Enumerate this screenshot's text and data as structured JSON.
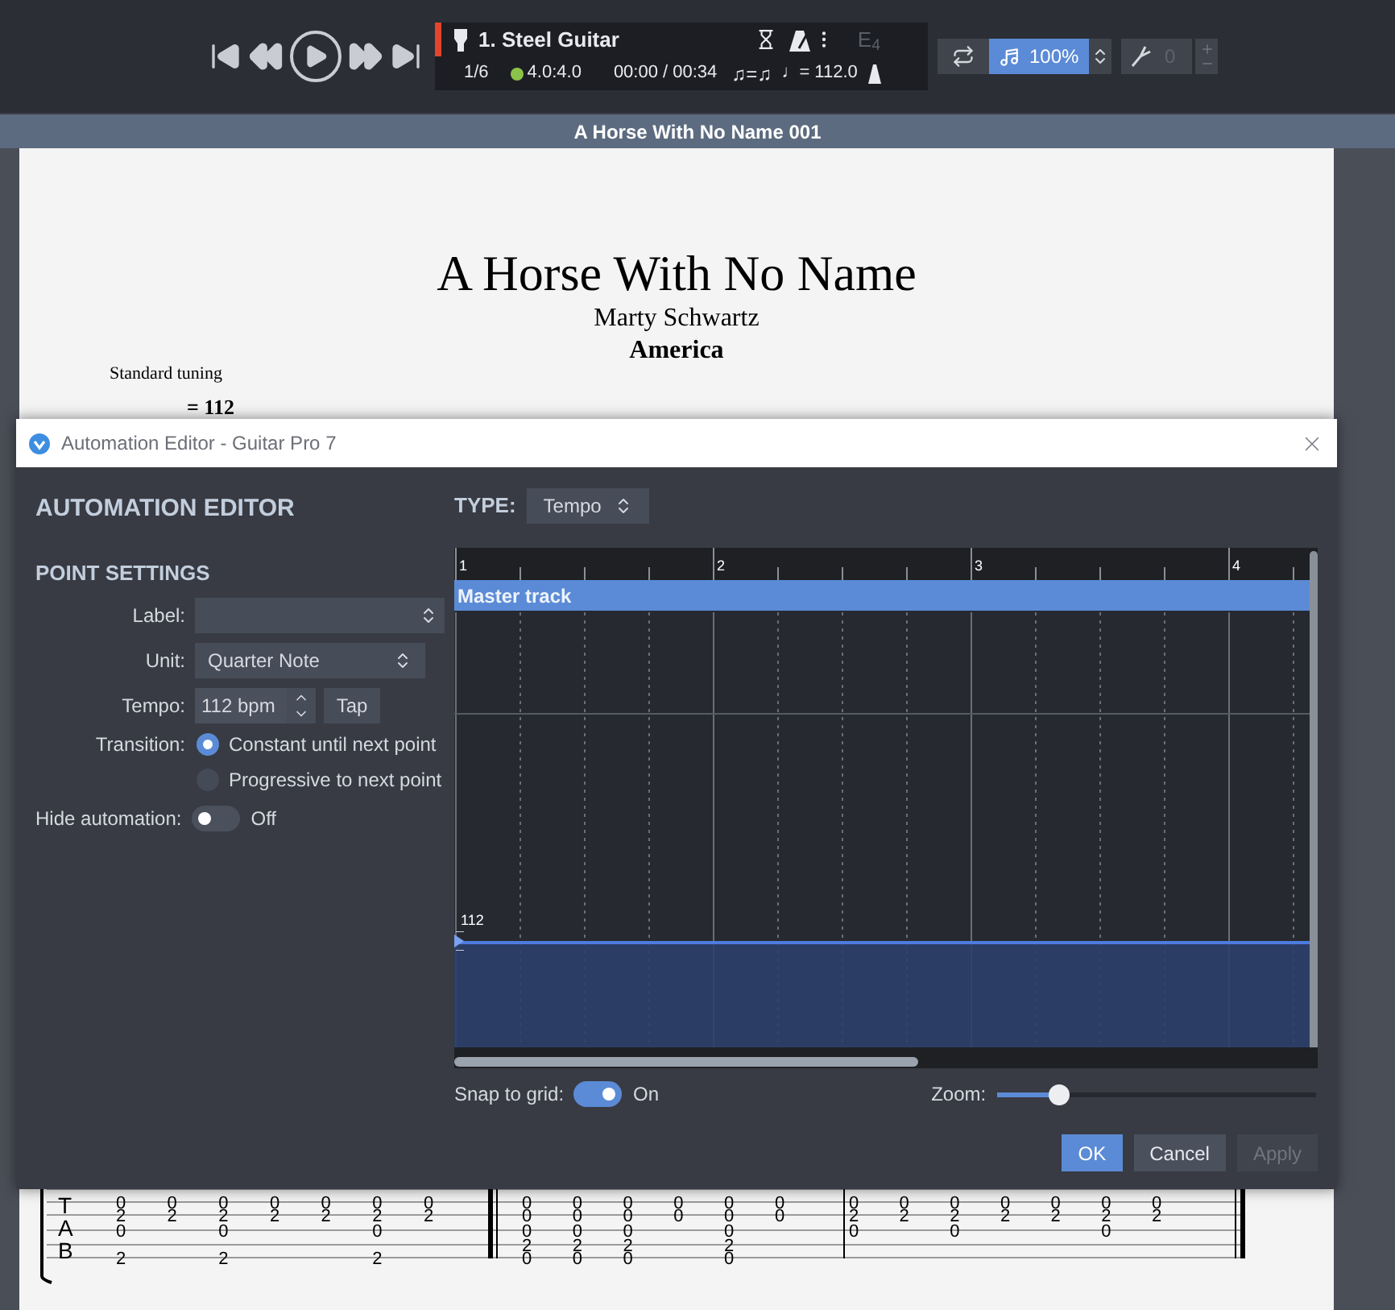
{
  "toolbar": {
    "track": {
      "name": "1. Steel Guitar",
      "key": "E$_{4}$",
      "bar": "1/6",
      "signature": "4.0:4.0",
      "time": "00:00 / 00:34",
      "swing": "♫=♫",
      "tempo": "♩= 112.0"
    },
    "speed": {
      "value": "100%",
      "selected": true
    },
    "tuner": {
      "value": "0",
      "disabled": true
    }
  },
  "document": {
    "tab_title": "A Horse With No Name 001",
    "title": "A Horse With No Name",
    "subtitle": "Marty Schwartz",
    "artist": "America",
    "tuning": "Standard tuning",
    "tempo_mark": "= 112",
    "clef": [
      "T",
      "A",
      "B"
    ],
    "measures": [
      {
        "columns": [
          {
            "line_1": "0",
            "line_2": "2",
            "line_3": "0",
            "line_5": "2"
          },
          {
            "line_1": "0",
            "line_2": "2"
          },
          {
            "line_1": "0",
            "line_2": "2",
            "line_3": "0",
            "line_5": "2"
          },
          {
            "line_1": "0",
            "line_2": "2"
          },
          {
            "line_1": "0",
            "line_2": "2"
          },
          {
            "line_1": "0",
            "line_2": "2",
            "line_3": "0",
            "line_5": "2"
          },
          {
            "line_1": "0",
            "line_2": "2"
          }
        ]
      },
      {
        "columns": [
          {
            "line_1": "0",
            "line_2": "0",
            "line_3": "0",
            "line_4": "2",
            "line_5": "0"
          },
          {
            "line_1": "0",
            "line_2": "0",
            "line_3": "0",
            "line_4": "2",
            "line_5": "0"
          },
          {
            "line_1": "0",
            "line_2": "0",
            "line_3": "0",
            "line_4": "2",
            "line_5": "0"
          },
          {
            "line_1": "0",
            "line_2": "0"
          },
          {
            "line_1": "0",
            "line_2": "0",
            "line_3": "0",
            "line_4": "2",
            "line_5": "0"
          },
          {
            "line_1": "0",
            "line_2": "0"
          }
        ]
      },
      {
        "columns": [
          {
            "line_1": "0",
            "line_2": "2",
            "line_3": "0"
          },
          {
            "line_1": "0",
            "line_2": "2"
          },
          {
            "line_1": "0",
            "line_2": "2",
            "line_3": "0"
          },
          {
            "line_1": "0",
            "line_2": "2"
          },
          {
            "line_1": "0",
            "line_2": "2"
          },
          {
            "line_1": "0",
            "line_2": "2",
            "line_3": "0"
          },
          {
            "line_1": "0",
            "line_2": "2"
          }
        ]
      }
    ]
  },
  "dialog": {
    "title": "Automation Editor - Guitar Pro 7",
    "heading": "AUTOMATION EDITOR",
    "section": "POINT SETTINGS",
    "label_field": {
      "label": "Label:"
    },
    "unit_field": {
      "label": "Unit:",
      "value": "Quarter Note"
    },
    "tempo_field": {
      "label": "Tempo:",
      "value": "112 bpm",
      "tap": "Tap"
    },
    "transition": {
      "label": "Transition:",
      "options": [
        {
          "label": "Constant until next point",
          "selected": true
        },
        {
          "label": "Progressive to next point",
          "selected": false
        }
      ]
    },
    "hide_automation": {
      "label": "Hide automation:",
      "on": false,
      "state_text": "Off"
    },
    "type": {
      "label": "TYPE:",
      "value": "Tempo"
    },
    "ruler": [
      "1",
      "2",
      "3",
      "4"
    ],
    "track_label": "Master track",
    "point_value": "112",
    "snap": {
      "label": "Snap to grid:",
      "on": true,
      "state_text": "On"
    },
    "zoom": {
      "label": "Zoom:",
      "level": 0.19
    },
    "buttons": [
      {
        "label": "OK",
        "kind": "primary"
      },
      {
        "label": "Cancel",
        "kind": "normal"
      },
      {
        "label": "Apply",
        "kind": "disabled"
      }
    ]
  }
}
